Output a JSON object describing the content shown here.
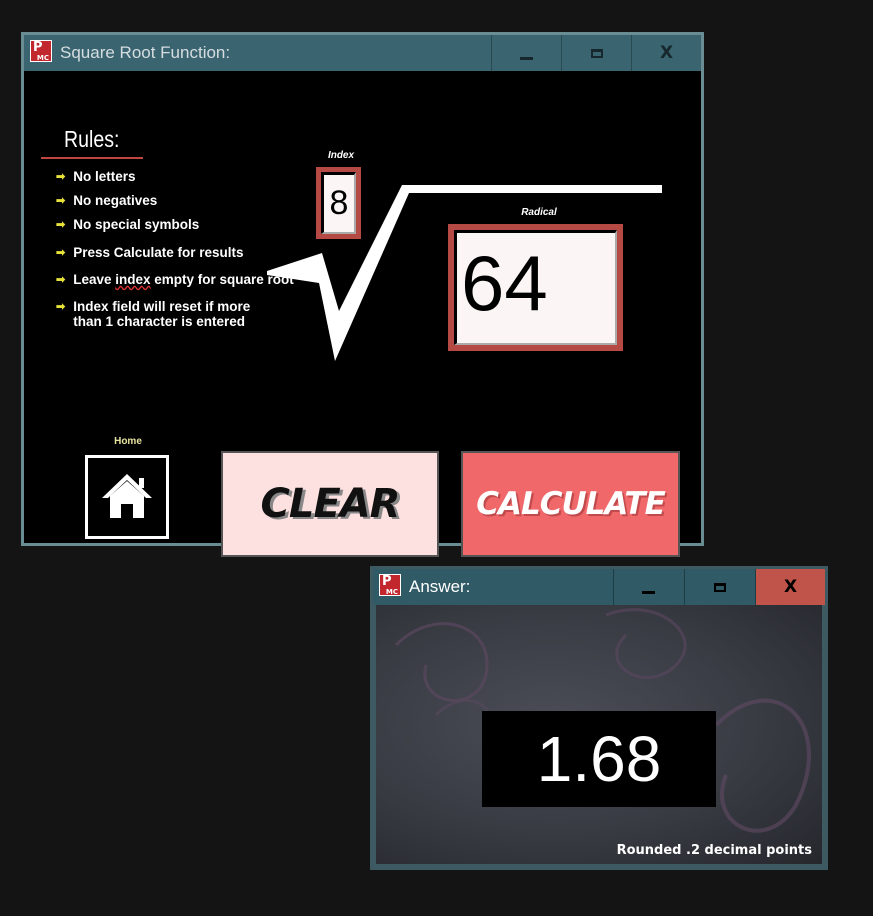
{
  "main_window": {
    "title": "Square Root Function:",
    "icon": "app-pmc-icon",
    "icon_text_p": "P",
    "icon_text_mc": "MC",
    "controls": {
      "minimize": "minimize-icon",
      "maximize": "maximize-icon",
      "close_label": "X"
    }
  },
  "rules": {
    "title": "Rules:",
    "items": [
      "No letters",
      "No negatives",
      "No special symbols",
      "Press Calculate for results",
      "Leave index empty for square root",
      "Index field will reset if more",
      "than 1 character is entered"
    ]
  },
  "index": {
    "label": "Index",
    "value": "8"
  },
  "radical": {
    "label": "Radical",
    "value": "64"
  },
  "home": {
    "label": "Home",
    "icon": "home-icon"
  },
  "buttons": {
    "clear": "CLEAR",
    "calculate": "CALCULATE"
  },
  "answer_window": {
    "title": "Answer:",
    "icon_text_p": "P",
    "icon_text_mc": "MC",
    "controls": {
      "minimize": "minimize-icon",
      "maximize": "maximize-icon",
      "close_label": "X"
    },
    "result": "1.68",
    "note": "Rounded .2 decimal points"
  },
  "colors": {
    "titlebar": "#3a6570",
    "accent_red": "#b54a44",
    "clear_bg": "#fde0e0",
    "calculate_bg": "#f0686a",
    "arrow": "#e7e23a"
  }
}
